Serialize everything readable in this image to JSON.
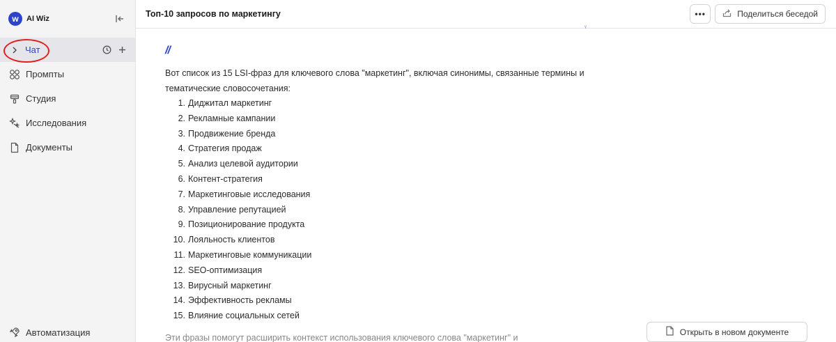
{
  "brand": {
    "name": "AI Wiz",
    "logo_letter": "w"
  },
  "sidebar": {
    "chat_label": "Чат",
    "items": [
      {
        "label": "Промпты",
        "icon": "grid-icon"
      },
      {
        "label": "Студия",
        "icon": "brush-icon"
      },
      {
        "label": "Исследования",
        "icon": "sparkle-icon"
      },
      {
        "label": "Документы",
        "icon": "document-icon"
      }
    ],
    "automation_label": "Автоматизация"
  },
  "header": {
    "title": "Топ-10 запросов по маркетингу",
    "more_label": "•••",
    "share_label": "Поделиться беседой"
  },
  "message": {
    "marker": "//",
    "intro": "Вот список из 15 LSI-фраз для ключевого слова \"маркетинг\", включая синонимы, связанные термины и тематические словосочетания:",
    "list": [
      {
        "num": "1.",
        "text": "Диджитал маркетинг"
      },
      {
        "num": "2.",
        "text": "Рекламные кампании"
      },
      {
        "num": "3.",
        "text": "Продвижение бренда"
      },
      {
        "num": "4.",
        "text": "Стратегия продаж"
      },
      {
        "num": "5.",
        "text": "Анализ целевой аудитории"
      },
      {
        "num": "6.",
        "text": "Контент-стратегия"
      },
      {
        "num": "7.",
        "text": "Маркетинговые исследования"
      },
      {
        "num": "8.",
        "text": "Управление репутацией"
      },
      {
        "num": "9.",
        "text": "Позиционирование продукта"
      },
      {
        "num": "10.",
        "text": "Лояльность клиентов"
      },
      {
        "num": "11.",
        "text": "Маркетинговые коммуникации"
      },
      {
        "num": "12.",
        "text": "SEO-оптимизация"
      },
      {
        "num": "13.",
        "text": "Вирусный маркетинг"
      },
      {
        "num": "14.",
        "text": "Эффективность рекламы"
      },
      {
        "num": "15.",
        "text": "Влияние социальных сетей"
      }
    ],
    "trailing_text": "Эти фразы помогут расширить контекст использования ключевого слова \"маркетинг\" и"
  },
  "open_doc_label": "Открыть в новом документе",
  "colors": {
    "accent": "#2c44c8",
    "annotation": "#e0201c",
    "sidebar_bg": "#f4f4f5"
  }
}
